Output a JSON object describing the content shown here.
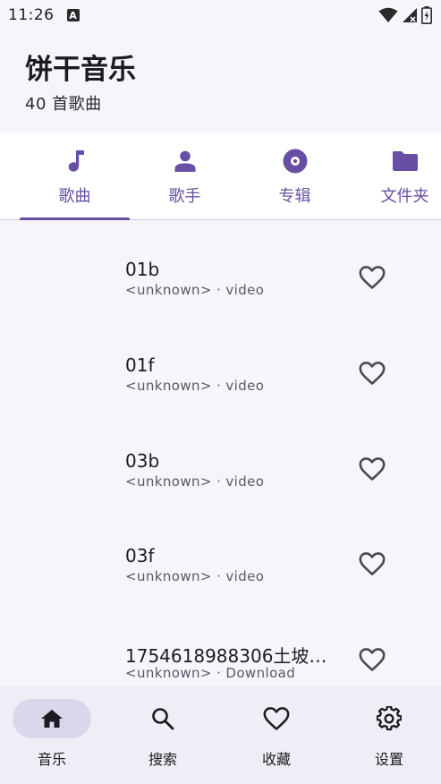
{
  "status": {
    "time": "11:26",
    "notif_letter": "A"
  },
  "header": {
    "title": "饼干音乐",
    "subtitle": "40 首歌曲"
  },
  "tabs": [
    {
      "label": "歌曲",
      "icon": "music-note-icon"
    },
    {
      "label": "歌手",
      "icon": "person-icon"
    },
    {
      "label": "专辑",
      "icon": "album-icon"
    },
    {
      "label": "文件夹",
      "icon": "folder-icon"
    }
  ],
  "songs": [
    {
      "title": "01b",
      "subtitle": "<unknown> · video"
    },
    {
      "title": "01f",
      "subtitle": "<unknown> · video"
    },
    {
      "title": "03b",
      "subtitle": "<unknown> · video"
    },
    {
      "title": "03f",
      "subtitle": "<unknown> · video"
    },
    {
      "title": "1754618988306土坡上…",
      "subtitle": "<unknown> · Download"
    }
  ],
  "bottom_nav": [
    {
      "label": "音乐",
      "icon": "home-icon",
      "active": true
    },
    {
      "label": "搜索",
      "icon": "search-icon",
      "active": false
    },
    {
      "label": "收藏",
      "icon": "heart-icon",
      "active": false
    },
    {
      "label": "设置",
      "icon": "settings-icon",
      "active": false
    }
  ],
  "colors": {
    "accent": "#6750a4",
    "background": "#f6f5fb",
    "nav_background": "#efedf5",
    "nav_active_pill": "#dcd6ec"
  }
}
